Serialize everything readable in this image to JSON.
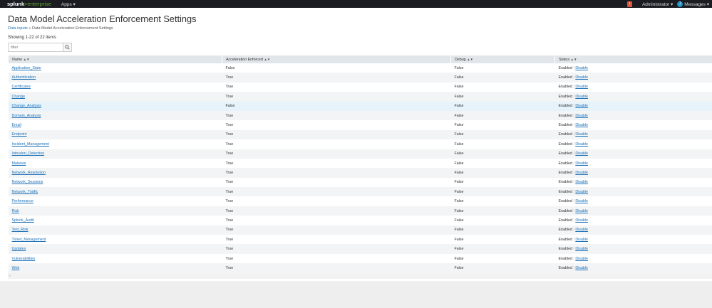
{
  "topbar": {
    "logo_main": "splunk",
    "logo_suffix": ">enterprise",
    "apps_label": "Apps ▾",
    "alert_count": "!",
    "admin_label": "Administrator ▾",
    "messages_count": "7",
    "messages_label": "Messages ▾"
  },
  "page": {
    "title": "Data Model Acceleration Enforcement Settings",
    "breadcrumb_link": "Data inputs",
    "breadcrumb_sep": "»",
    "breadcrumb_current": "Data Model Acceleration Enforcement Settings",
    "count_text": "Showing 1-22 of 22 items"
  },
  "filter": {
    "placeholder": "filter"
  },
  "table": {
    "columns": [
      "Name",
      "Acceleration Enforced",
      "Debug",
      "Status"
    ],
    "enabled_label": "Enabled",
    "disable_label": "Disable",
    "rows": [
      {
        "name": "Application_State",
        "enforced": "False",
        "debug": "False"
      },
      {
        "name": "Authentication",
        "enforced": "True",
        "debug": "False"
      },
      {
        "name": "Certificates",
        "enforced": "True",
        "debug": "False"
      },
      {
        "name": "Change",
        "enforced": "True",
        "debug": "False"
      },
      {
        "name": "Change_Analysis",
        "enforced": "False",
        "debug": "False"
      },
      {
        "name": "Domain_Analysis",
        "enforced": "True",
        "debug": "False"
      },
      {
        "name": "Email",
        "enforced": "True",
        "debug": "False"
      },
      {
        "name": "Endpoint",
        "enforced": "True",
        "debug": "False"
      },
      {
        "name": "Incident_Management",
        "enforced": "True",
        "debug": "False"
      },
      {
        "name": "Intrusion_Detection",
        "enforced": "True",
        "debug": "False"
      },
      {
        "name": "Malware",
        "enforced": "True",
        "debug": "False"
      },
      {
        "name": "Network_Resolution",
        "enforced": "True",
        "debug": "False"
      },
      {
        "name": "Network_Sessions",
        "enforced": "True",
        "debug": "False"
      },
      {
        "name": "Network_Traffic",
        "enforced": "True",
        "debug": "False"
      },
      {
        "name": "Performance",
        "enforced": "True",
        "debug": "False"
      },
      {
        "name": "Risk",
        "enforced": "True",
        "debug": "False"
      },
      {
        "name": "Splunk_Audit",
        "enforced": "True",
        "debug": "False"
      },
      {
        "name": "Test_Risk",
        "enforced": "True",
        "debug": "False"
      },
      {
        "name": "Ticket_Management",
        "enforced": "True",
        "debug": "False"
      },
      {
        "name": "Updates",
        "enforced": "True",
        "debug": "False"
      },
      {
        "name": "Vulnerabilities",
        "enforced": "True",
        "debug": "False"
      },
      {
        "name": "Web",
        "enforced": "True",
        "debug": "False"
      }
    ]
  },
  "scroll_left_glyph": "‹",
  "icons": {
    "search": "search-icon",
    "sort": "sort-icon"
  }
}
